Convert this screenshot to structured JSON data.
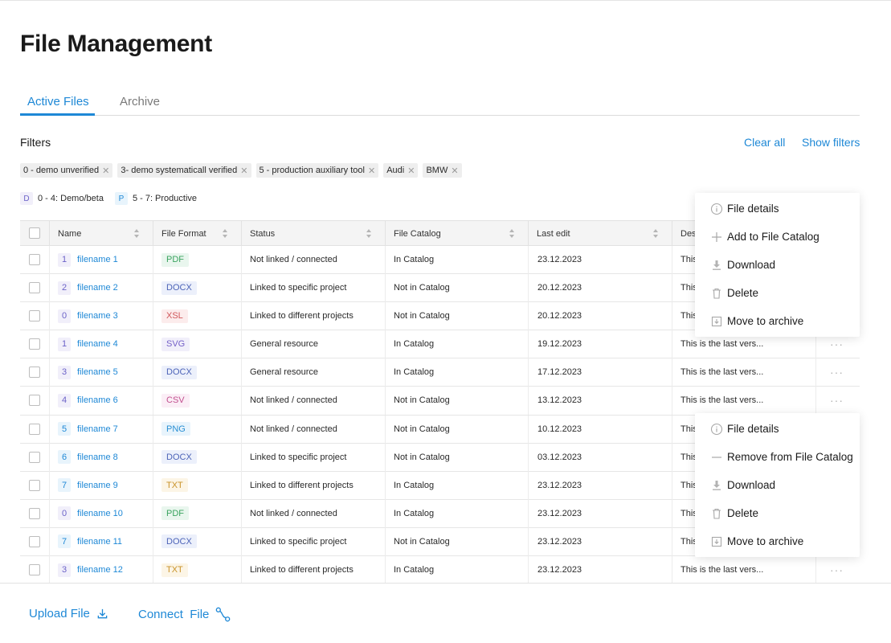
{
  "page_title": "File Management",
  "tabs": [
    {
      "label": "Active Files",
      "active": true
    },
    {
      "label": "Archive",
      "active": false
    }
  ],
  "filters": {
    "label": "Filters",
    "clear_all": "Clear all",
    "show_filters": "Show filters",
    "chips": [
      "0 - demo unverified",
      "3- demo systematicall verified",
      "5 - production auxiliary tool",
      "Audi",
      "BMW"
    ],
    "legend": [
      {
        "badge": "D",
        "label": "0 - 4: Demo/beta",
        "bg": "#f1effa",
        "fg": "#6b62c8"
      },
      {
        "badge": "P",
        "label": "5 - 7: Productive",
        "bg": "#e8f4fc",
        "fg": "#1e88d6"
      }
    ]
  },
  "table": {
    "columns": [
      "Name",
      "File Format",
      "Status",
      "File Catalog",
      "Last edit",
      "Des"
    ],
    "rows": [
      {
        "idx": "1",
        "name": "filename 1",
        "format": "PDF",
        "status": "Not linked / connected",
        "catalog": "In Catalog",
        "edit": "23.12.2023",
        "desc": "This",
        "dots": ""
      },
      {
        "idx": "2",
        "name": "filename 2",
        "format": "DOCX",
        "status": "Linked to specific project",
        "catalog": "Not in Catalog",
        "edit": "20.12.2023",
        "desc": "This",
        "dots": ""
      },
      {
        "idx": "0",
        "name": "filename 3",
        "format": "XSL",
        "status": "Linked to different projects",
        "catalog": "Not in Catalog",
        "edit": "20.12.2023",
        "desc": "This",
        "dots": ""
      },
      {
        "idx": "1",
        "name": "filename 4",
        "format": "SVG",
        "status": "General resource",
        "catalog": "In Catalog",
        "edit": "19.12.2023",
        "desc": "This is the last vers...",
        "dots": "···"
      },
      {
        "idx": "3",
        "name": "filename 5",
        "format": "DOCX",
        "status": "General resource",
        "catalog": "In Catalog",
        "edit": "17.12.2023",
        "desc": "This is the last vers...",
        "dots": "···"
      },
      {
        "idx": "4",
        "name": "filename 6",
        "format": "CSV",
        "status": "Not linked / connected",
        "catalog": "Not in Catalog",
        "edit": "13.12.2023",
        "desc": "This is the last vers...",
        "dots": "···"
      },
      {
        "idx": "5",
        "name": "filename 7",
        "format": "PNG",
        "status": "Not linked / connected",
        "catalog": "Not in Catalog",
        "edit": "10.12.2023",
        "desc": "This",
        "dots": ""
      },
      {
        "idx": "6",
        "name": "filename 8",
        "format": "DOCX",
        "status": "Linked to specific project",
        "catalog": "Not in Catalog",
        "edit": "03.12.2023",
        "desc": "This",
        "dots": ""
      },
      {
        "idx": "7",
        "name": "filename 9",
        "format": "TXT",
        "status": "Linked to different projects",
        "catalog": "In Catalog",
        "edit": "23.12.2023",
        "desc": "This",
        "dots": ""
      },
      {
        "idx": "0",
        "name": "filename 10",
        "format": "PDF",
        "status": "Not linked / connected",
        "catalog": "In Catalog",
        "edit": "23.12.2023",
        "desc": "This",
        "dots": ""
      },
      {
        "idx": "7",
        "name": "filename 11",
        "format": "DOCX",
        "status": "Linked to specific project",
        "catalog": "Not in Catalog",
        "edit": "23.12.2023",
        "desc": "This",
        "dots": ""
      },
      {
        "idx": "3",
        "name": "filename 12",
        "format": "TXT",
        "status": "Linked to different projects",
        "catalog": "In Catalog",
        "edit": "23.12.2023",
        "desc": "This is the last vers...",
        "dots": "···"
      }
    ]
  },
  "format_colors": {
    "PDF": {
      "bg": "#e9f6ee",
      "fg": "#3aa35f"
    },
    "DOCX": {
      "bg": "#ecf0fb",
      "fg": "#4d64b8"
    },
    "XSL": {
      "bg": "#fcecec",
      "fg": "#d0575a"
    },
    "SVG": {
      "bg": "#f1effa",
      "fg": "#7560c8"
    },
    "CSV": {
      "bg": "#fbeef6",
      "fg": "#c2508f"
    },
    "PNG": {
      "bg": "#e8f4fc",
      "fg": "#2a8fd3"
    },
    "TXT": {
      "bg": "#fcf5e6",
      "fg": "#c9932a"
    }
  },
  "index_colors": {
    "demo": {
      "bg": "#f1effa",
      "fg": "#6b62c8"
    },
    "productive": {
      "bg": "#e8f4fc",
      "fg": "#1e88d6"
    }
  },
  "menus": [
    {
      "items": [
        {
          "label": "File details",
          "icon": "info-icon"
        },
        {
          "label": "Add to File Catalog",
          "icon": "plus-icon"
        },
        {
          "label": "Download",
          "icon": "download-icon"
        },
        {
          "label": "Delete",
          "icon": "trash-icon"
        },
        {
          "label": "Move to archive",
          "icon": "archive-icon"
        }
      ]
    },
    {
      "items": [
        {
          "label": "File details",
          "icon": "info-icon"
        },
        {
          "label": "Remove from File Catalog",
          "icon": "minus-icon"
        },
        {
          "label": "Download",
          "icon": "download-icon"
        },
        {
          "label": "Delete",
          "icon": "trash-icon"
        },
        {
          "label": "Move to archive",
          "icon": "archive-icon"
        }
      ]
    }
  ],
  "footer": {
    "upload": "Upload File",
    "connect": "Connect  File"
  },
  "accent": "#1e88d6"
}
